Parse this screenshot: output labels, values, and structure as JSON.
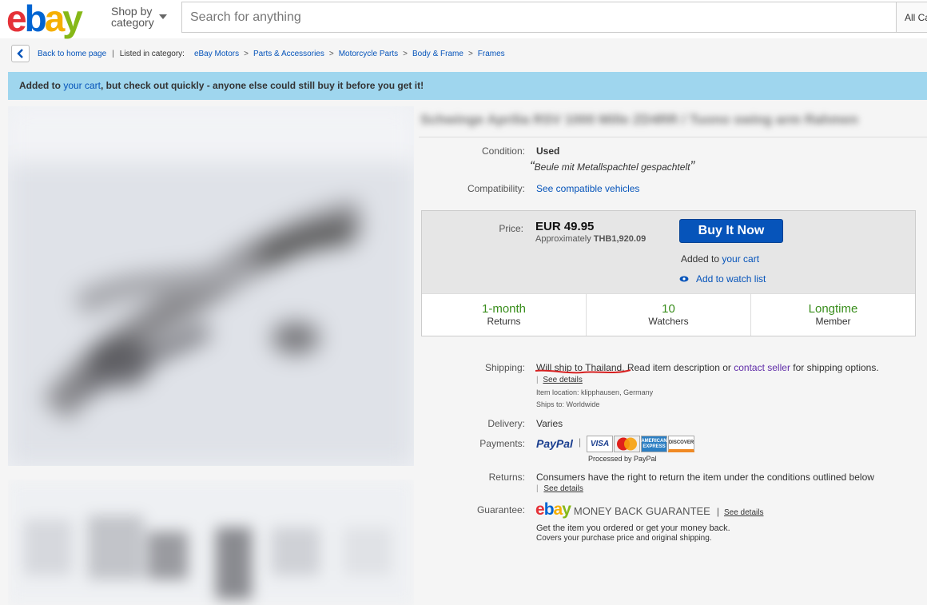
{
  "header": {
    "logo": {
      "e": "e",
      "b": "b",
      "a": "a",
      "y": "y"
    },
    "shop_by_line1": "Shop by",
    "shop_by_line2": "category",
    "search_placeholder": "Search for anything",
    "all_categories": "All Ca"
  },
  "breadcrumb": {
    "back": "Back to home page",
    "listed_in": "Listed in category:",
    "items": [
      "eBay Motors",
      "Parts & Accessories",
      "Motorcycle Parts",
      "Body & Frame",
      "Frames"
    ]
  },
  "banner": {
    "prefix": "Added to ",
    "link": "your cart",
    "suffix": ", but check out quickly - anyone else could still buy it before you get it!"
  },
  "listing": {
    "title": "Schwinge Aprilia RSV 1000 Mille ZD4RR / Tuono swing arm Rahmen",
    "condition_label": "Condition:",
    "condition_value": "Used",
    "condition_note_open": "“",
    "condition_note": "Beule mit Metallspachtel gespachtelt",
    "condition_note_close": "”",
    "compat_label": "Compatibility:",
    "compat_link": "See compatible vehicles"
  },
  "price": {
    "label": "Price:",
    "value": "EUR 49.95",
    "approx_prefix": "Approximately ",
    "approx_value": "THB1,920.09",
    "buy_button": "Buy It Now",
    "added_prefix": "Added to ",
    "added_link": "your cart",
    "watch_link": "Add to watch list",
    "stats": [
      {
        "big": "1-month",
        "small": "Returns"
      },
      {
        "big": "10",
        "small": "Watchers"
      },
      {
        "big": "Longtime",
        "small": "Member"
      }
    ]
  },
  "shipping": {
    "label": "Shipping:",
    "highlight": "Will ship to Thailand",
    "mid": ". Read item description or ",
    "contact": "contact seller",
    "end": " for shipping options.",
    "see_details": "See details",
    "location": "Item location:  klipphausen, Germany",
    "ships_to": "Ships to:  Worldwide"
  },
  "delivery": {
    "label": "Delivery:",
    "value": "Varies"
  },
  "payments": {
    "label": "Payments:",
    "paypal": "PayPal",
    "cards": [
      "VISA",
      "MasterCard",
      "AMERICAN EXPRESS",
      "DISCOVER"
    ],
    "processed": "Processed by PayPal"
  },
  "returns": {
    "label": "Returns:",
    "value": "Consumers have the right to return the item under the conditions outlined below",
    "see_details": "See details"
  },
  "guarantee": {
    "label": "Guarantee:",
    "money_back": "MONEY BACK GUARANTEE",
    "see_details": "See details",
    "line1": "Get the item you ordered or get your money back.",
    "line2": "Covers your purchase price and original shipping."
  },
  "colors": {
    "ebay_red": "#e53238",
    "ebay_blue": "#0064d2",
    "ebay_yellow": "#f5af02",
    "ebay_green": "#86b817",
    "link": "#0654ba",
    "banner": "#9fd6ee",
    "stat_green": "#3a8e1d"
  }
}
